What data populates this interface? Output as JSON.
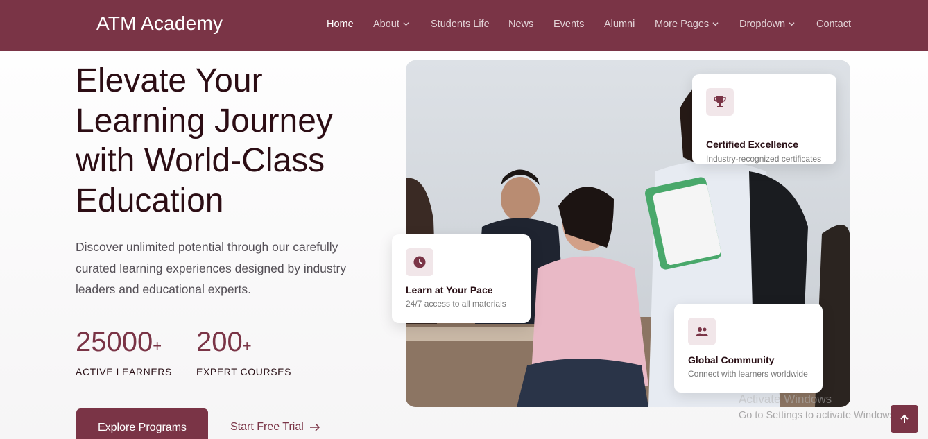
{
  "header": {
    "logo": "ATM Academy",
    "nav": [
      {
        "label": "Home",
        "active": true,
        "dropdown": false
      },
      {
        "label": "About",
        "active": false,
        "dropdown": true
      },
      {
        "label": "Students Life",
        "active": false,
        "dropdown": false
      },
      {
        "label": "News",
        "active": false,
        "dropdown": false
      },
      {
        "label": "Events",
        "active": false,
        "dropdown": false
      },
      {
        "label": "Alumni",
        "active": false,
        "dropdown": false
      },
      {
        "label": "More Pages",
        "active": false,
        "dropdown": true
      },
      {
        "label": "Dropdown",
        "active": false,
        "dropdown": true
      },
      {
        "label": "Contact",
        "active": false,
        "dropdown": false
      }
    ]
  },
  "hero": {
    "title_lines": [
      "Elevate Your",
      "Learning Journey",
      "with World-Class",
      "Education"
    ],
    "description": "Discover unlimited potential through our carefully curated learning experiences designed by industry leaders and educational experts.",
    "stats": [
      {
        "number": "25000",
        "suffix": "+",
        "label": "ACTIVE LEARNERS"
      },
      {
        "number": "200",
        "suffix": "+",
        "label": "EXPERT COURSES"
      }
    ],
    "primary_button": "Explore Programs",
    "secondary_link": "Start Free Trial"
  },
  "cards": [
    {
      "icon": "trophy-icon",
      "title": "Certified Excellence",
      "subtitle": "Industry-recognized certificates"
    },
    {
      "icon": "clock-icon",
      "title": "Learn at Your Pace",
      "subtitle": "24/7 access to all materials"
    },
    {
      "icon": "people-icon",
      "title": "Global Community",
      "subtitle": "Connect with learners worldwide"
    }
  ],
  "watermark": {
    "line1": "Activate Windows",
    "line2": "Go to Settings to activate Windows."
  },
  "colors": {
    "brand": "#7a3446",
    "heading": "#2c0d14",
    "icon_bg": "#f1e6e9"
  }
}
